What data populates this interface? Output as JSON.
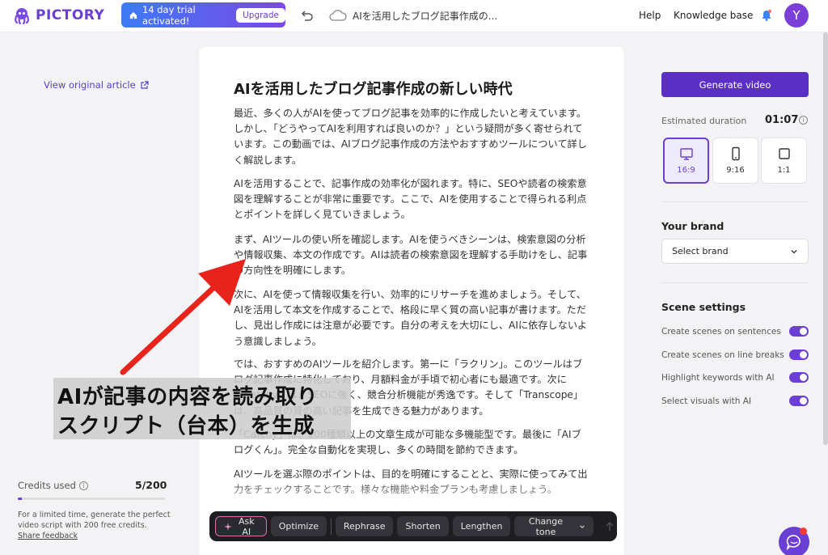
{
  "topbar": {
    "logo_text": "PICTORY",
    "trial_text": "14 day trial activated!",
    "upgrade_label": "Upgrade",
    "doc_title": "AIを活用したブログ記事作成の...",
    "help": "Help",
    "knowledge_base": "Knowledge base",
    "avatar_initial": "Y"
  },
  "left": {
    "view_original": "View original article",
    "credits_label": "Credits used",
    "credits_value": "5/200",
    "credits_fraction": 0.025,
    "credits_note": "For a limited time, generate the perfect video script with 200 free credits.",
    "share_feedback": "Share feedback"
  },
  "script": {
    "title": "AIを活用したブログ記事作成の新しい時代",
    "paragraphs": [
      "最近、多くの人がAIを使ってブログ記事を効率的に作成したいと考えています。しかし、「どうやってAIを利用すれば良いのか？」という疑問が多く寄せられています。この動画では、AIブログ記事作成の方法やおすすめツールについて詳しく解説します。",
      "AIを活用することで、記事作成の効率化が図れます。特に、SEOや読者の検索意図を理解することが非常に重要です。ここで、AIを使用することで得られる利点とポイントを詳しく見ていきましょう。",
      "まず、AIツールの使い所を確認します。AIを使うべきシーンは、検索意図の分析や情報収集、本文の作成です。AIは読者の検索意図を理解する手助けをし、記事の方向性を明確にします。",
      "次に、AIを使って情報収集を行い、効率的にリサーチを進めましょう。そして、AIを活用して本文を作成することで、格段に早く質の高い記事が書けます。ただし、見出し作成には注意が必要です。自分の考えを大切にし、AIに依存しないよう意識しましょう。",
      "では、おすすめのAIツールを紹介します。第一に「ラクリン」。このツールはブログ記事作成に特化しており、月額料金が手頃で初心者にも最適です。次に「Catchy」は、SEOに強く、競合分析機能が秀逸です。そして「Transcope」は、高品質の質の高い記事を生成できる魅力があります。",
      "「Catchy」は、100種類以上の文章生成が可能な多機能型です。最後に「AIブログくん」。完全な自動化を実現し、多くの時間を節約できます。",
      "AIツールを選ぶ際のポイントは、目的を明確にすることと、実際に使ってみて出力をチェックすることです。様々な機能や料金プランも考慮しましょう。"
    ]
  },
  "toolbar": {
    "ask_ai": "Ask AI",
    "optimize": "Optimize",
    "rephrase": "Rephrase",
    "shorten": "Shorten",
    "lengthen": "Lengthen",
    "change_tone": "Change tone"
  },
  "right": {
    "generate_video": "Generate video",
    "estimated_duration_label": "Estimated duration",
    "estimated_duration_value": "01:07",
    "ratios": [
      {
        "label": "16:9",
        "icon": "monitor-icon",
        "selected": true
      },
      {
        "label": "9:16",
        "icon": "phone-icon",
        "selected": false
      },
      {
        "label": "1:1",
        "icon": "square-icon",
        "selected": false
      }
    ],
    "your_brand_title": "Your brand",
    "select_brand": "Select brand",
    "scene_settings_title": "Scene settings",
    "toggles": [
      {
        "label": "Create scenes on sentences",
        "on": true
      },
      {
        "label": "Create scenes on line breaks",
        "on": true
      },
      {
        "label": "Highlight keywords with AI",
        "on": true
      },
      {
        "label": "Select visuals with AI",
        "on": true
      }
    ]
  },
  "annotation": {
    "line1": "AIが記事の内容を読み取り",
    "line2": "スクリプト（台本）を生成"
  },
  "colors": {
    "brand": "#6b3fd4",
    "arrow": "#e8231b"
  }
}
